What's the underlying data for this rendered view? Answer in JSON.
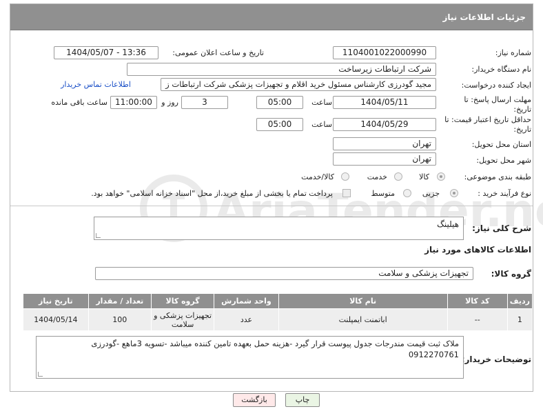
{
  "header": {
    "title": "جزئیات اطلاعات نیاز"
  },
  "form": {
    "need_number": {
      "label": "شماره نیاز:",
      "value": "1104001022000990"
    },
    "announce": {
      "label": "تاریخ و ساعت اعلان عمومی:",
      "value": "1404/05/07 - 13:36"
    },
    "buyer_org": {
      "label": "نام دستگاه خریدار:",
      "value": "شرکت ارتباطات زیرساخت"
    },
    "creator": {
      "label": "ایجاد کننده درخواست:",
      "value": "مجید گودرزی کارشناس مسئول خرید اقلام و تجهیزات پزشکی شرکت ارتباطات ز",
      "contact_link": "اطلاعات تماس خریدار"
    },
    "reply_deadline": {
      "label": "مهلت ارسال پاسخ: تا تاریخ:",
      "date": "1404/05/11",
      "time_label": "ساعت",
      "time": "05:00",
      "days": "3",
      "days_label": "روز و",
      "remaining": "11:00:00",
      "remaining_label": "ساعت باقی مانده"
    },
    "price_validity": {
      "label": "حداقل تاریخ اعتبار قیمت: تا تاریخ:",
      "date": "1404/05/29",
      "time_label": "ساعت",
      "time": "05:00"
    },
    "province": {
      "label": "استان محل تحویل:",
      "value": "تهران"
    },
    "city": {
      "label": "شهر محل تحویل:",
      "value": "تهران"
    },
    "category": {
      "label": "طبقه بندی موضوعی:",
      "options": [
        "کالا",
        "خدمت",
        "کالا/خدمت"
      ],
      "selected": "کالا"
    },
    "purchase_type": {
      "label": "نوع فرآیند خرید :",
      "options": [
        "جزیی",
        "متوسط"
      ],
      "selected": "جزیی",
      "payment_note": "پرداخت تمام یا بخشی از مبلغ خرید،از محل \"اسناد خزانه اسلامی\" خواهد بود."
    }
  },
  "description": {
    "label": "شرح کلی نیاز:",
    "value": "هیلینگ"
  },
  "goods_info": {
    "title": "اطلاعات کالاهای مورد نیاز"
  },
  "goods_group": {
    "label": "گروه کالا:",
    "value": "تجهیزات پزشکی و سلامت"
  },
  "table": {
    "headers": [
      "ردیف",
      "کد کالا",
      "نام کالا",
      "واحد شمارش",
      "گروه کالا",
      "تعداد / مقدار",
      "تاریخ نیاز"
    ],
    "rows": [
      [
        "1",
        "--",
        "اباتمنت ایمپلنت",
        "عدد",
        "تجهیزات پزشکی و سلامت",
        "100",
        "1404/05/14"
      ]
    ]
  },
  "buyer_notes": {
    "label": "توضیحات خریدار:",
    "value": "ملاک ثبت قیمت مندرجات جدول پیوست قرار گیرد -هزینه حمل بعهده تامین کننده میباشد -تسویه 3ماهع -گودرزی 0912270761"
  },
  "buttons": {
    "print": "چاپ",
    "back": "بازگشت"
  },
  "watermark": {
    "text": "AriaTender.neT"
  },
  "colors": {
    "header_bg": "#909090",
    "link": "#1a4fc7",
    "back_btn": "#ffe9e9",
    "print_btn": "#eaf5e4"
  }
}
